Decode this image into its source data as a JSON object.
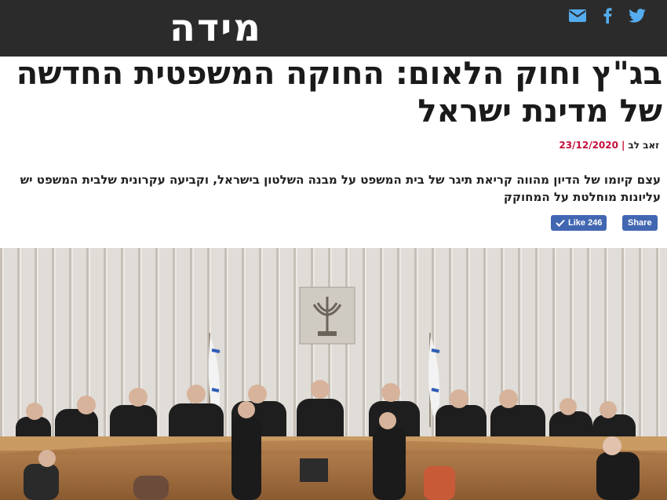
{
  "site": {
    "logo_text": "מידה"
  },
  "social": [
    {
      "name": "twitter-icon",
      "color": "#55acee"
    },
    {
      "name": "facebook-icon",
      "color": "#55acee"
    },
    {
      "name": "email-icon",
      "color": "#55acee"
    }
  ],
  "article": {
    "title": "בג\"ץ וחוק הלאום: החוקה המשפטית החדשה של מדינת ישראל",
    "author": "זאב לב",
    "date": "23/12/2020",
    "lead": "עצם קיומו של הדיון מהווה קריאת תיגר של בית המשפט על מבנה השלטון בישראל, וקביעה עקרונית שלבית המשפט יש עליונות מוחלטת על המחוקק"
  },
  "facebook": {
    "like_label": "Like 246",
    "share_label": "Share"
  },
  "colors": {
    "topbar": "#2b2b2b",
    "accent_date": "#c2103a",
    "fb_blue": "#4267b2"
  },
  "image": {
    "subject": "photo-supreme-court-hearing"
  }
}
